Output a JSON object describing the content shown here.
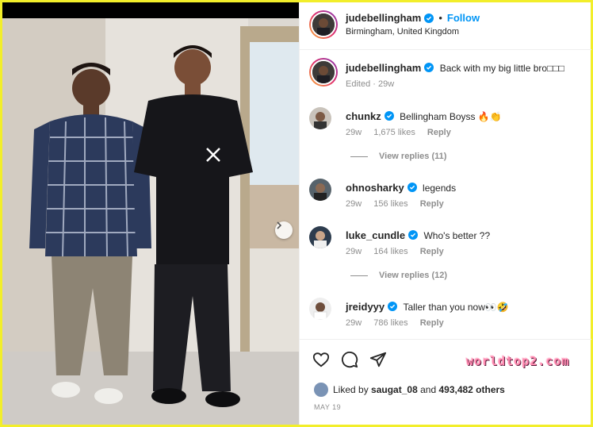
{
  "post": {
    "image_alt": "Two young men posing in a showroom",
    "next_arrow": "chevron-right-icon"
  },
  "header": {
    "username": "judebellingham",
    "follow_label": "Follow",
    "separator": "•",
    "location": "Birmingham, United Kingdom"
  },
  "caption": {
    "username": "judebellingham",
    "text": "Back with my big little bro□□□",
    "edited": "Edited · 29w"
  },
  "comments": [
    {
      "username": "chunkz",
      "text": "Bellingham Boyss 🔥👏",
      "age": "29w",
      "likes": "1,675 likes",
      "reply": "Reply",
      "verified": true
    },
    {
      "username": "ohnosharky",
      "text": "legends",
      "age": "29w",
      "likes": "156 likes",
      "reply": "Reply",
      "verified": true
    },
    {
      "username": "luke_cundle",
      "text": "Who's better ??",
      "age": "29w",
      "likes": "164 likes",
      "reply": "Reply",
      "verified": true
    },
    {
      "username": "jreidyyy",
      "text": "Taller than you now👀🤣",
      "age": "29w",
      "likes": "786 likes",
      "reply": "Reply",
      "verified": true
    }
  ],
  "view_replies": [
    "View replies (11)",
    "View replies (12)"
  ],
  "actions": {
    "like_icon": "heart-icon",
    "comment_icon": "comment-icon",
    "share_icon": "send-icon"
  },
  "likes": {
    "prefix": "Liked by",
    "user": "saugat_08",
    "middle": "and",
    "count": "493,482 others"
  },
  "date": "MAY 19",
  "watermark": "worldtop2.com",
  "colors": {
    "accent": "#0095f6",
    "border": "#f2ee2a",
    "muted": "#8e8e8e"
  }
}
